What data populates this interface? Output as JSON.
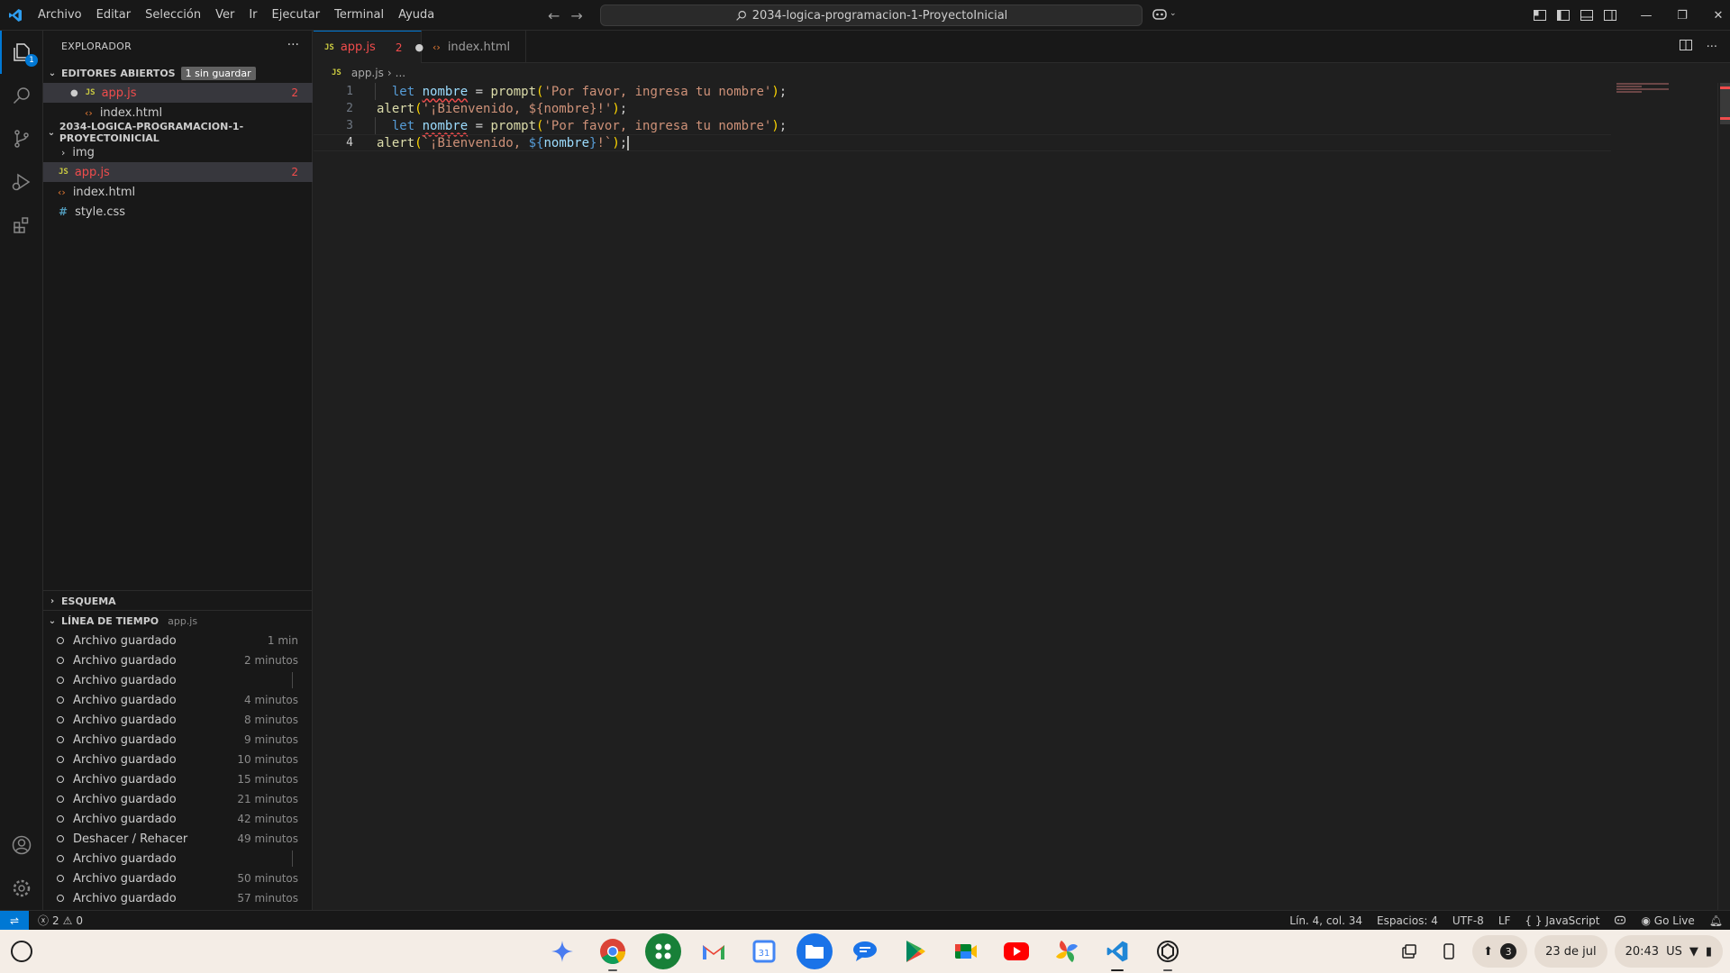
{
  "titlebar": {
    "menu": [
      "Archivo",
      "Editar",
      "Selección",
      "Ver",
      "Ir",
      "Ejecutar",
      "Terminal",
      "Ayuda"
    ],
    "search_text": "2034-logica-programacion-1-ProyectoInicial"
  },
  "activity": {
    "explorer_badge": "1"
  },
  "sidebar": {
    "title": "EXPLORADOR",
    "more": "···",
    "open_editors": {
      "label": "EDITORES ABIERTOS",
      "unsaved": "1 sin guardar",
      "items": [
        {
          "name": "app.js",
          "errors": "2"
        },
        {
          "name": "index.html"
        }
      ]
    },
    "project": {
      "label": "2034-LOGICA-PROGRAMACION-1-PROYECTOINICIAL",
      "items": [
        {
          "name": "img"
        },
        {
          "name": "app.js",
          "errors": "2"
        },
        {
          "name": "index.html"
        },
        {
          "name": "style.css"
        }
      ]
    },
    "outline": {
      "label": "ESQUEMA"
    },
    "timeline": {
      "label": "LÍNEA DE TIEMPO",
      "file": "app.js",
      "items": [
        {
          "label": "Archivo guardado",
          "time": "1 min"
        },
        {
          "label": "Archivo guardado",
          "time": "2 minutos"
        },
        {
          "label": "Archivo guardado",
          "time": ""
        },
        {
          "label": "Archivo guardado",
          "time": "4 minutos"
        },
        {
          "label": "Archivo guardado",
          "time": "8 minutos"
        },
        {
          "label": "Archivo guardado",
          "time": "9 minutos"
        },
        {
          "label": "Archivo guardado",
          "time": "10 minutos"
        },
        {
          "label": "Archivo guardado",
          "time": "15 minutos"
        },
        {
          "label": "Archivo guardado",
          "time": "21 minutos"
        },
        {
          "label": "Archivo guardado",
          "time": "42 minutos"
        },
        {
          "label": "Deshacer / Rehacer",
          "time": "49 minutos"
        },
        {
          "label": "Archivo guardado",
          "time": ""
        },
        {
          "label": "Archivo guardado",
          "time": "50 minutos"
        },
        {
          "label": "Archivo guardado",
          "time": "57 minutos"
        }
      ]
    }
  },
  "editor": {
    "tabs": [
      {
        "name": "app.js",
        "errors": "2",
        "modified": "●"
      },
      {
        "name": "index.html"
      }
    ],
    "breadcrumb": {
      "file": "app.js",
      "rest": "..."
    },
    "line_numbers": [
      "1",
      "2",
      "3",
      "4"
    ],
    "code": {
      "l1": {
        "indent": "  ",
        "kw": "let",
        "var": "nombre",
        "op": " = ",
        "fn": "prompt",
        "open": "(",
        "str": "'Por favor, ingresa tu nombre'",
        "close": ")",
        "end": ";"
      },
      "l2": {
        "fn": "alert",
        "open": "(",
        "str": "'¡Bienvenido, ${nombre}!'",
        "close": ")",
        "end": ";"
      },
      "l3": {
        "indent": "  ",
        "kw": "let",
        "var": "nombre",
        "op": " = ",
        "fn": "prompt",
        "open": "(",
        "str": "'Por favor, ingresa tu nombre'",
        "close": ")",
        "end": ";"
      },
      "l4": {
        "fn": "alert",
        "open": "(",
        "str1": "`¡Bienvenido, ",
        "tmpl_open": "${",
        "var": "nombre",
        "tmpl_close": "}",
        "str2": "!`",
        "close": ")",
        "end": ";"
      }
    }
  },
  "statusbar": {
    "errors": "2",
    "warnings": "0",
    "position": "Lín. 4, col. 34",
    "spaces": "Espacios: 4",
    "encoding": "UTF-8",
    "eol": "LF",
    "language": "JavaScript",
    "golive": "Go Live"
  },
  "shelf": {
    "notifications": "3",
    "date": "23 de jul",
    "time": "20:43",
    "locale": "US"
  },
  "colors": {
    "accent": "#0078d4",
    "error": "#f14c4c"
  }
}
